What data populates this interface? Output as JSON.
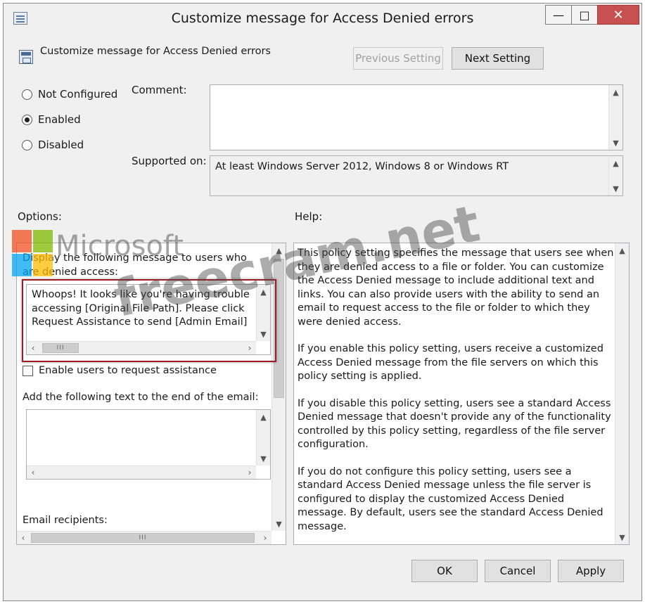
{
  "window": {
    "title": "Customize message for Access Denied errors",
    "controls": {
      "minimize": "—",
      "maximize": "□",
      "close": "✕"
    }
  },
  "header": {
    "policy_name": "Customize message for Access Denied errors",
    "previous_setting": "Previous Setting",
    "next_setting": "Next Setting"
  },
  "state": {
    "not_configured": "Not Configured",
    "enabled": "Enabled",
    "disabled": "Disabled",
    "selected": "Enabled"
  },
  "comment": {
    "label": "Comment:",
    "value": ""
  },
  "supported_on": {
    "label": "Supported on:",
    "value": "At least Windows Server 2012, Windows 8 or Windows RT"
  },
  "options": {
    "label": "Options:",
    "display_message_label": "Display the following message to users who are denied access:",
    "message_lines": [
      "Whoops! It looks like you're having trouble",
      "accessing [Original File Path]. Please click",
      "Request Assistance to send [Admin Email]"
    ],
    "enable_request_label": "Enable users to request assistance",
    "enable_request_checked": false,
    "email_text_label": "Add the following text to the end of the email:",
    "email_text_value": "",
    "email_recipients_label": "Email recipients:"
  },
  "help": {
    "label": "Help:",
    "paragraphs": [
      "This policy setting specifies the message that users see when they are denied access to a file or folder. You can customize the Access Denied message to include additional text and links. You can also provide users with the ability to send an email to request access to the file or folder to which they were denied access.",
      "If you enable this policy setting, users receive a customized Access Denied message from the file servers on which this policy setting is applied.",
      "If you disable this policy setting, users see a standard Access Denied message that doesn't provide any of the functionality controlled by this policy setting, regardless of the file server configuration.",
      "If you do not configure this policy setting, users see a standard Access Denied message unless the file server is configured to display the customized Access Denied message. By default, users see the standard Access Denied message."
    ]
  },
  "footer": {
    "ok": "OK",
    "cancel": "Cancel",
    "apply": "Apply"
  },
  "scroll_glyphs": {
    "up": "▲",
    "down": "▼",
    "left": "‹",
    "right": "›",
    "grip": "III"
  },
  "watermark": {
    "microsoft": "Microsoft",
    "site": "freecram.net"
  },
  "colors": {
    "close_button": "#c75050",
    "highlight_border": "#9b1c23"
  }
}
